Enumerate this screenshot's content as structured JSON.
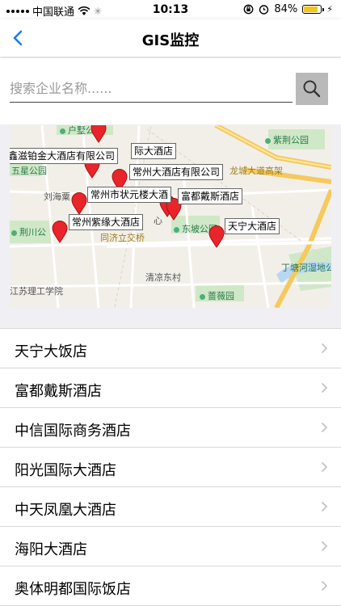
{
  "status_bar": {
    "carrier": "中国联通",
    "time": "10:13",
    "battery_percent": "84%",
    "battery_level": 0.84,
    "battery_color": "#f5c518"
  },
  "nav": {
    "title": "GIS监控",
    "back_icon": "chevron-left-icon"
  },
  "search": {
    "placeholder": "搜索企业名称......",
    "value": "",
    "button_icon": "search-icon"
  },
  "map": {
    "labels": {
      "hupo": "户墅公园",
      "zijing": "紫荆公园",
      "wuxing": "五星公园",
      "liuhai": "刘海粟",
      "jingchuan": "荆川公",
      "tongji": "同济立交桥",
      "dongpo": "东坡公园",
      "qingliang": "清凉东村",
      "qiangwei": "蔷薇园",
      "jiangsu": "江苏理工学院",
      "dingtang": "丁塘河湿地公",
      "longcheng": "龙城大道高架",
      "xin": "心"
    },
    "callouts": {
      "c1": "鑫滋铂金大酒店有限公司",
      "c2": "际大酒店",
      "c3": "常州大酒店有限公司",
      "c4": "常州市状元楼大酒",
      "c5": "富都戴斯酒店",
      "c6": "常州紫缘大酒店",
      "c7": "天宁大酒店"
    }
  },
  "hotels": [
    "天宁大饭店",
    "富都戴斯酒店",
    "中信国际商务酒店",
    "阳光国际大酒店",
    "中天凤凰大酒店",
    "海阳大酒店",
    "奥体明都国际饭店"
  ]
}
